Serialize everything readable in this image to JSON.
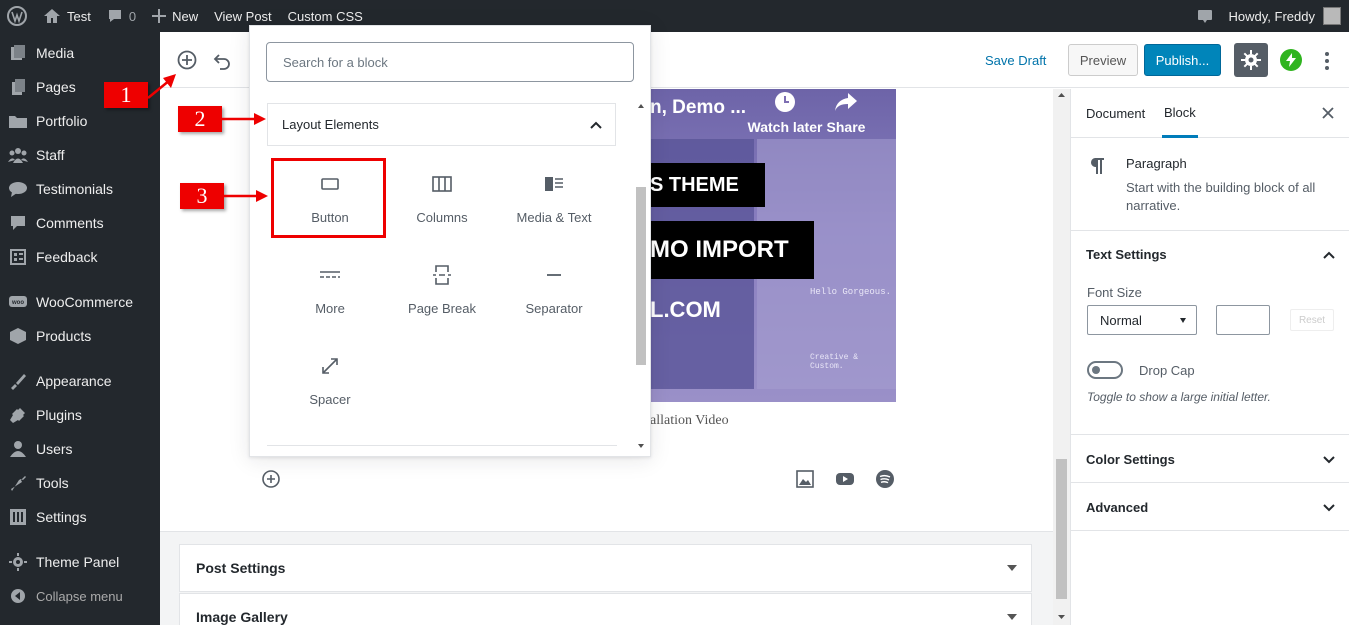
{
  "adminbar": {
    "site_name": "Test",
    "comments_count": "0",
    "new_label": "New",
    "view_post": "View Post",
    "custom_css": "Custom CSS",
    "howdy": "Howdy, Freddy"
  },
  "sidebar": {
    "items": [
      {
        "label": "Media",
        "icon": "media-icon"
      },
      {
        "label": "Pages",
        "icon": "pages-icon"
      },
      {
        "label": "Portfolio",
        "icon": "portfolio-icon"
      },
      {
        "label": "Staff",
        "icon": "staff-icon"
      },
      {
        "label": "Testimonials",
        "icon": "testimonials-icon"
      },
      {
        "label": "Comments",
        "icon": "comments-icon"
      },
      {
        "label": "Feedback",
        "icon": "feedback-icon"
      },
      {
        "label": "WooCommerce",
        "icon": "woocommerce-icon"
      },
      {
        "label": "Products",
        "icon": "products-icon"
      },
      {
        "label": "Appearance",
        "icon": "appearance-icon"
      },
      {
        "label": "Plugins",
        "icon": "plugins-icon"
      },
      {
        "label": "Users",
        "icon": "users-icon"
      },
      {
        "label": "Tools",
        "icon": "tools-icon"
      },
      {
        "label": "Settings",
        "icon": "settings-icon"
      },
      {
        "label": "Theme Panel",
        "icon": "theme-panel-icon"
      }
    ],
    "collapse": "Collapse menu"
  },
  "header": {
    "save_draft": "Save Draft",
    "preview": "Preview",
    "publish": "Publish..."
  },
  "inserter": {
    "search_placeholder": "Search for a block",
    "panel_title": "Layout Elements",
    "blocks": [
      "Button",
      "Columns",
      "Media & Text",
      "More",
      "Page Break",
      "Separator",
      "Spacer"
    ]
  },
  "video": {
    "title_fragment": "n, Demo ...",
    "watch_later": "Watch later",
    "share": "Share",
    "banner1": "S THEME",
    "banner2": "MO IMPORT",
    "banner3": "L.COM",
    "thumb_text1": "Hello Gorgeous.",
    "thumb_text2": "Creative & Custom."
  },
  "caption": "allation Video",
  "metaboxes": {
    "post_settings": "Post Settings",
    "image_gallery": "Image Gallery"
  },
  "settings": {
    "tab_document": "Document",
    "tab_block": "Block",
    "block_name": "Paragraph",
    "block_desc": "Start with the building block of all narrative.",
    "text_settings": "Text Settings",
    "font_size_label": "Font Size",
    "font_size_value": "Normal",
    "reset": "Reset",
    "drop_cap": "Drop Cap",
    "drop_cap_help": "Toggle to show a large initial letter.",
    "color_settings": "Color Settings",
    "advanced": "Advanced"
  },
  "annotations": {
    "step1": "1",
    "step2": "2",
    "step3": "3",
    "color": "#e00000"
  }
}
